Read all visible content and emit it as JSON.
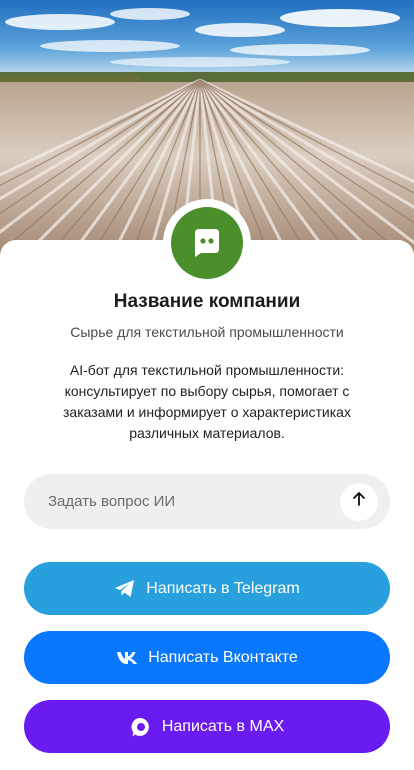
{
  "company": {
    "name": "Название компании",
    "tagline": "Сырье для текстильной промышленности",
    "description": "AI-бот для текстильной промышленности: консультирует по выбору сырья, помогает с заказами и информирует о характеристиках различных материалов."
  },
  "ask": {
    "placeholder": "Задать вопрос ИИ",
    "send_icon": "arrow-up-icon"
  },
  "buttons": {
    "telegram": {
      "label": "Написать в Telegram",
      "icon": "telegram-icon",
      "color": "#29a0de"
    },
    "vk": {
      "label": "Написать Вконтакте",
      "icon": "vk-icon",
      "color": "#0a77ff"
    },
    "max": {
      "label": "Написать в MAX",
      "icon": "max-icon",
      "color": "#6a1bf0"
    }
  },
  "colors": {
    "avatar": "#4a8f2c",
    "input_bg": "#efefef"
  }
}
